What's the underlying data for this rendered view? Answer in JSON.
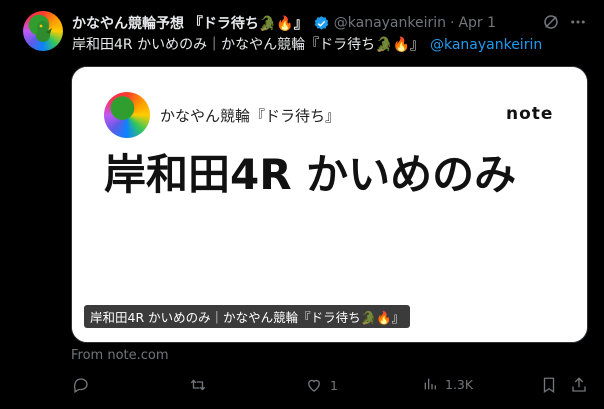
{
  "tweet": {
    "display_name": "かなやん競輪予想 『ドラ待ち🐊🔥』",
    "handle": "@kanayankeirin",
    "separator": "·",
    "time": "Apr 1",
    "text": "岸和田4R かいめのみ｜かなやん競輪『ドラ待ち🐊🔥』",
    "mention": "@kanayankeirin",
    "colors": {
      "accent": "#1d9bf0",
      "text": "#e7e9ea",
      "muted": "#71767b",
      "bg": "#000000"
    }
  },
  "card": {
    "author": "かなやん競輪『ドラ待ち』",
    "logo": "note",
    "title": "岸和田4R かいめのみ",
    "caption": "岸和田4R かいめのみ｜かなやん競輪『ドラ待ち🐊🔥』",
    "source": "From note.com"
  },
  "actions": {
    "reply_count": "",
    "retweet_count": "",
    "like_count": "1",
    "views_count": "1.3K"
  },
  "icons": [
    "verified-icon",
    "grok-icon",
    "more-icon",
    "reply-icon",
    "retweet-icon",
    "like-icon",
    "views-icon",
    "bookmark-icon",
    "share-icon"
  ]
}
